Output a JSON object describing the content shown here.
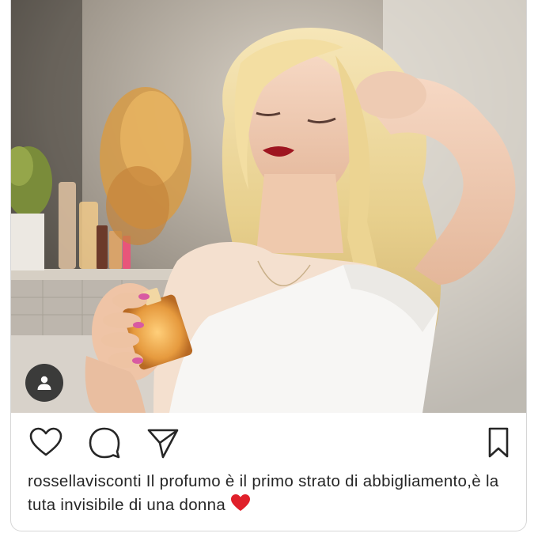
{
  "post": {
    "username": "rossellavisconti",
    "caption_text": " Il profumo è il primo strato di abbigliamento,è la tuta invisibile di una donna ",
    "caption_emoji": "red-heart-emoji"
  },
  "icons": {
    "like": "heart-outline-icon",
    "comment": "comment-bubble-icon",
    "share": "paper-plane-icon",
    "save": "bookmark-icon",
    "tag": "user-tag-icon"
  },
  "colors": {
    "text": "#262626",
    "heart": "#e0202a",
    "tag_bg": "#333333"
  }
}
